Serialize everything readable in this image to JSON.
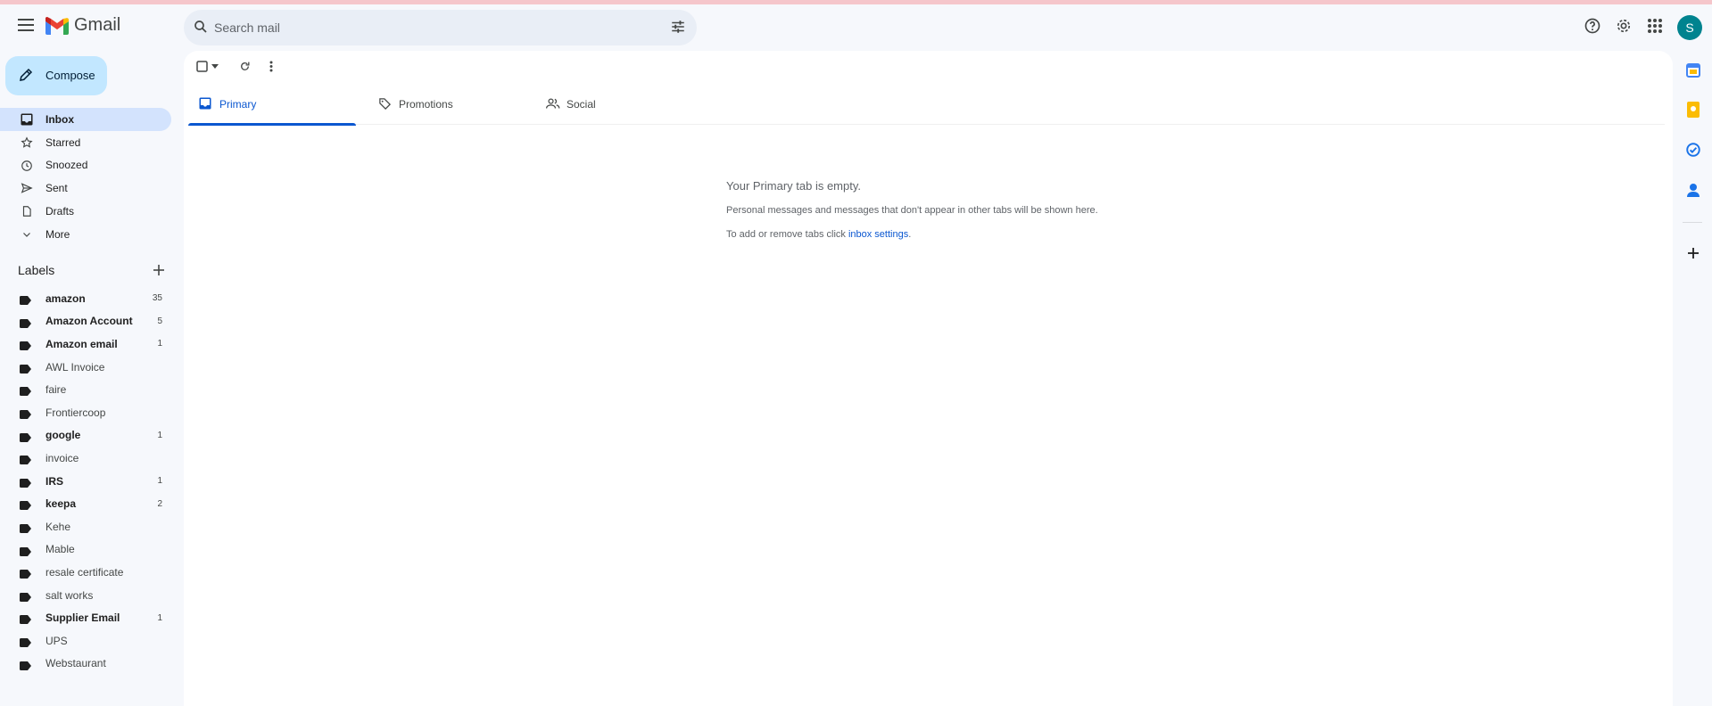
{
  "app": {
    "name": "Gmail"
  },
  "search": {
    "placeholder": "Search mail"
  },
  "account": {
    "initial": "S"
  },
  "compose": {
    "label": "Compose"
  },
  "nav": [
    {
      "label": "Inbox",
      "icon": "inbox-icon",
      "active": true
    },
    {
      "label": "Starred",
      "icon": "star-icon"
    },
    {
      "label": "Snoozed",
      "icon": "clock-icon"
    },
    {
      "label": "Sent",
      "icon": "send-icon"
    },
    {
      "label": "Drafts",
      "icon": "draft-icon"
    },
    {
      "label": "More",
      "icon": "chevron-down-icon"
    }
  ],
  "labels_title": "Labels",
  "labels": [
    {
      "name": "amazon",
      "count": "35",
      "bold": true
    },
    {
      "name": "Amazon Account",
      "count": "5",
      "bold": true
    },
    {
      "name": "Amazon email",
      "count": "1",
      "bold": true
    },
    {
      "name": "AWL Invoice",
      "count": "",
      "bold": false
    },
    {
      "name": "faire",
      "count": "",
      "bold": false
    },
    {
      "name": "Frontiercoop",
      "count": "",
      "bold": false
    },
    {
      "name": "google",
      "count": "1",
      "bold": true
    },
    {
      "name": "invoice",
      "count": "",
      "bold": false
    },
    {
      "name": "IRS",
      "count": "1",
      "bold": true
    },
    {
      "name": "keepa",
      "count": "2",
      "bold": true
    },
    {
      "name": "Kehe",
      "count": "",
      "bold": false
    },
    {
      "name": "Mable",
      "count": "",
      "bold": false
    },
    {
      "name": "resale certificate",
      "count": "",
      "bold": false
    },
    {
      "name": "salt works",
      "count": "",
      "bold": false
    },
    {
      "name": "Supplier Email",
      "count": "1",
      "bold": true
    },
    {
      "name": "UPS",
      "count": "",
      "bold": false
    },
    {
      "name": "Webstaurant",
      "count": "",
      "bold": false
    }
  ],
  "tabs": [
    {
      "label": "Primary",
      "icon": "inbox-tab-icon",
      "active": true
    },
    {
      "label": "Promotions",
      "icon": "tag-icon"
    },
    {
      "label": "Social",
      "icon": "people-icon"
    }
  ],
  "empty": {
    "title": "Your Primary tab is empty.",
    "line1": "Personal messages and messages that don't appear in other tabs will be shown here.",
    "line2_prefix": "To add or remove tabs click ",
    "line2_link": "inbox settings",
    "line2_suffix": "."
  },
  "colors": {
    "accent": "#0b57d0",
    "compose_bg": "#c2e7ff",
    "nav_active_bg": "#d3e3fd",
    "avatar_bg": "#00838f"
  }
}
